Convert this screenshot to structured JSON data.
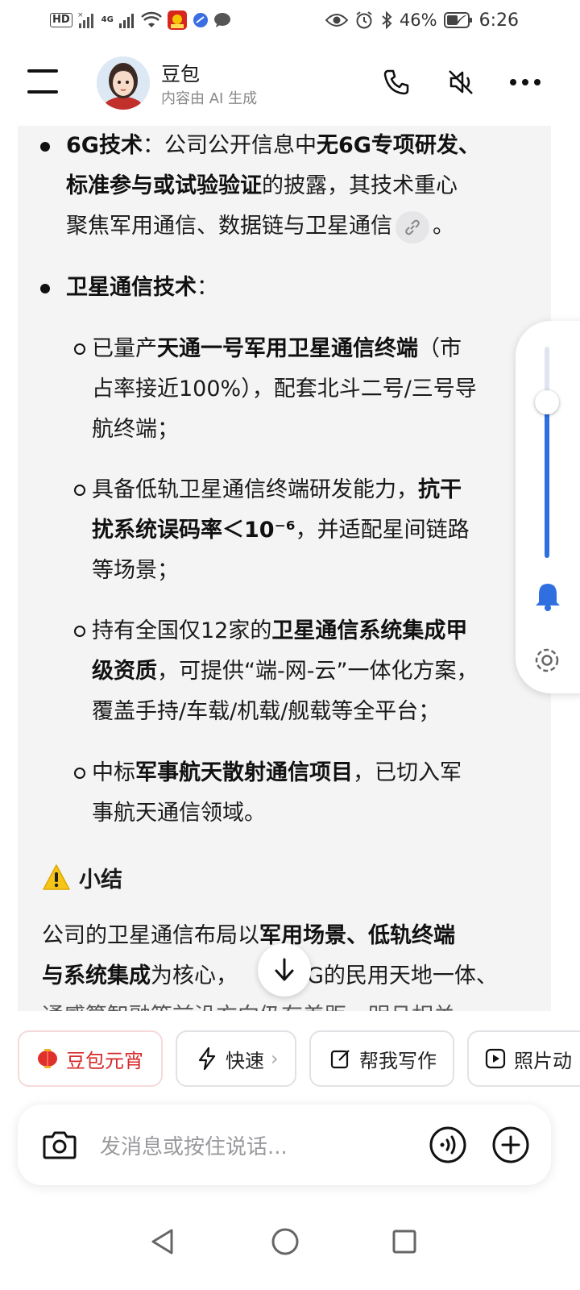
{
  "status_bar": {
    "hd_label": "HD",
    "network_4g": "4G",
    "battery_percent": "46%",
    "time": "6:26"
  },
  "header": {
    "bot_name": "豆包",
    "bot_subtitle": "内容由 AI 生成"
  },
  "content": {
    "item_6g": {
      "title": "6G技术",
      "sep": "：",
      "text_a": "公司公开信息中",
      "bold_b": "无6G专项研发、",
      "bold_c": "标准参与或试验验证",
      "text_d": "的披露，其技术重心",
      "text_e": "聚焦军用通信、数据链与卫星通信",
      "text_end": "。"
    },
    "item_sat": {
      "title": "卫星通信技术",
      "sep": "："
    },
    "sub_items": [
      {
        "line1_a": "已量产",
        "line1_bold": "天通一号军用卫星通信终端",
        "line1_b": "（市",
        "line2": "占率接近100%），配套北斗二号/三号导",
        "line3": "航终端；"
      },
      {
        "line1_a": "具备低轨卫星通信终端研发能力，",
        "line1_bold": "抗干",
        "line2_bold": "扰系统误码率＜10⁻⁶",
        "line2_b": "，并适配星间链路",
        "line3": "等场景；"
      },
      {
        "line1_a": "持有全国仅12家的",
        "line1_bold": "卫星通信系统集成甲",
        "line2_bold": "级资质",
        "line2_b": "，可提供“端-网-云”一体化方案，",
        "line3": "覆盖手持/车载/机载/舰载等全平台；"
      },
      {
        "line1_a": "中标",
        "line1_bold": "军事航天散射通信项目",
        "line1_b": "，已切入军",
        "line2": "事航天通信领域。"
      }
    ],
    "summary": {
      "heading": "小结",
      "line1_a": "公司的卫星通信布局以",
      "line1_bold": "军用场景、低轨终端",
      "line2_bold": "与系统集成",
      "line2_b": "为核心，",
      "line2_c": "G的民用天地一体、",
      "line3": "通感算智融等前沿方向仍有差距，明且相关"
    }
  },
  "chips": [
    {
      "label": "豆包元宵",
      "icon": "lantern-icon"
    },
    {
      "label": "快速",
      "icon": "lightning-icon",
      "suffix": "›"
    },
    {
      "label": "帮我写作",
      "icon": "edit-icon"
    },
    {
      "label": "照片动",
      "icon": "play-icon"
    }
  ],
  "input": {
    "placeholder": "发消息或按住说话..."
  },
  "colors": {
    "accent_blue": "#2f6fe0",
    "chip_red": "#d62a2a",
    "content_bg": "#f4f4f5"
  }
}
